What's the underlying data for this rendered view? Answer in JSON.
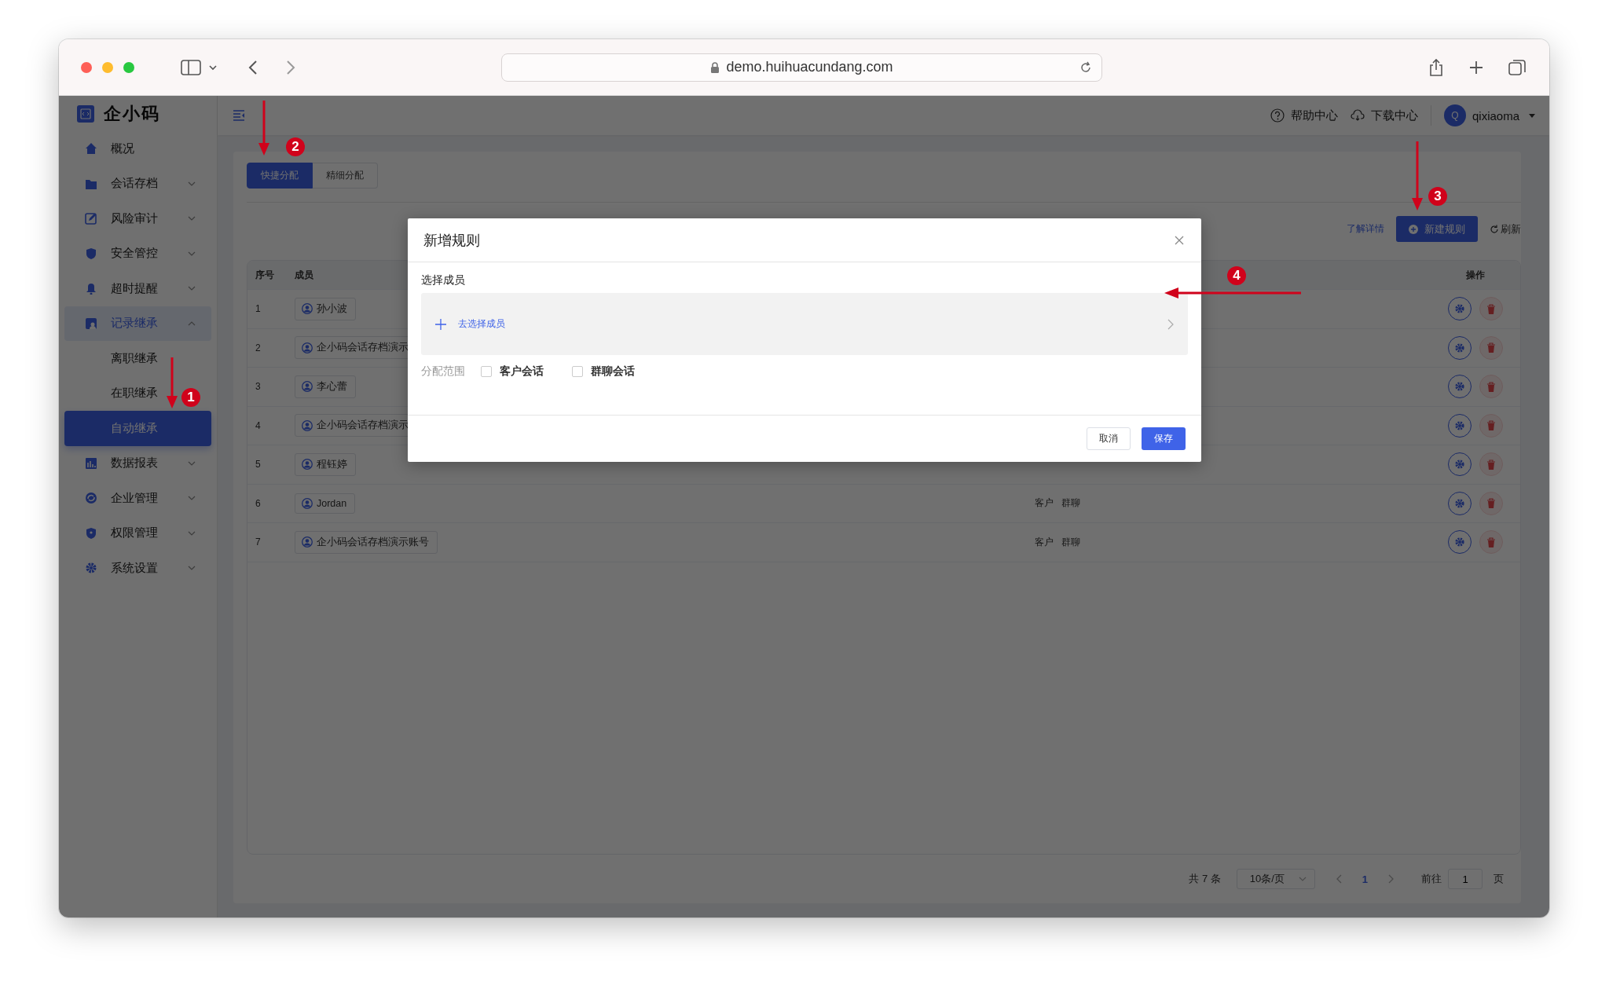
{
  "browser": {
    "url": "demo.huihuacundang.com"
  },
  "sidebar": {
    "logo": "企小码",
    "items": [
      {
        "label": "概况",
        "kind": "link",
        "selected": false
      },
      {
        "label": "会话存档",
        "kind": "group",
        "expanded": false,
        "selected": false
      },
      {
        "label": "风险审计",
        "kind": "group",
        "expanded": false,
        "selected": false
      },
      {
        "label": "安全管控",
        "kind": "group",
        "expanded": false,
        "selected": false
      },
      {
        "label": "超时提醒",
        "kind": "group",
        "expanded": false,
        "selected": false
      },
      {
        "label": "记录继承",
        "kind": "group",
        "expanded": true,
        "selected": true,
        "children": [
          {
            "label": "离职继承",
            "selected": false
          },
          {
            "label": "在职继承",
            "selected": false
          },
          {
            "label": "自动继承",
            "selected": true
          }
        ]
      },
      {
        "label": "数据报表",
        "kind": "group",
        "expanded": false,
        "selected": false
      },
      {
        "label": "企业管理",
        "kind": "group",
        "expanded": false,
        "selected": false
      },
      {
        "label": "权限管理",
        "kind": "group",
        "expanded": false,
        "selected": false
      },
      {
        "label": "系统设置",
        "kind": "group",
        "expanded": false,
        "selected": false
      }
    ]
  },
  "header": {
    "help": "帮助中心",
    "download": "下载中心",
    "user": {
      "initial": "Q",
      "name": "qixiaoma"
    }
  },
  "tabs": [
    {
      "label": "快捷分配",
      "selected": true
    },
    {
      "label": "精细分配",
      "selected": false
    }
  ],
  "toolbar": {
    "link": "了解详情",
    "new_button": "新建规则",
    "refresh": "刷新"
  },
  "table": {
    "columns": [
      "序号",
      "成员",
      "操作"
    ],
    "rows": [
      {
        "index": "1",
        "member": "孙小波",
        "scope": []
      },
      {
        "index": "2",
        "member": "企小码会话存档演示",
        "scope": []
      },
      {
        "index": "3",
        "member": "李心蕾",
        "scope": []
      },
      {
        "index": "4",
        "member": "企小码会话存档演示",
        "scope": []
      },
      {
        "index": "5",
        "member": "程钰婷",
        "scope": []
      },
      {
        "index": "6",
        "member": "Jordan",
        "scope": [
          "客户",
          "群聊"
        ]
      },
      {
        "index": "7",
        "member": "企小码会话存档演示账号",
        "scope": [
          "客户",
          "群聊"
        ]
      }
    ]
  },
  "pagination": {
    "total": "共 7 条",
    "page_size": "10条/页",
    "pages": [
      {
        "label": "1",
        "selected": true
      }
    ],
    "goto_label": "前往",
    "goto_value": "1",
    "goto_suffix": "页"
  },
  "modal": {
    "title": "新增规则",
    "member_label": "选择成员",
    "picker_text": "去选择成员",
    "scope_label": "分配范围",
    "options": [
      {
        "label": "客户会话",
        "checked": false
      },
      {
        "label": "群聊会话",
        "checked": false
      }
    ],
    "cancel": "取消",
    "save": "保存"
  },
  "annotations": [
    {
      "label": "1",
      "kind": "vertical"
    },
    {
      "label": "2",
      "kind": "vertical"
    },
    {
      "label": "3",
      "kind": "vertical"
    },
    {
      "label": "4",
      "kind": "horizontal"
    }
  ]
}
